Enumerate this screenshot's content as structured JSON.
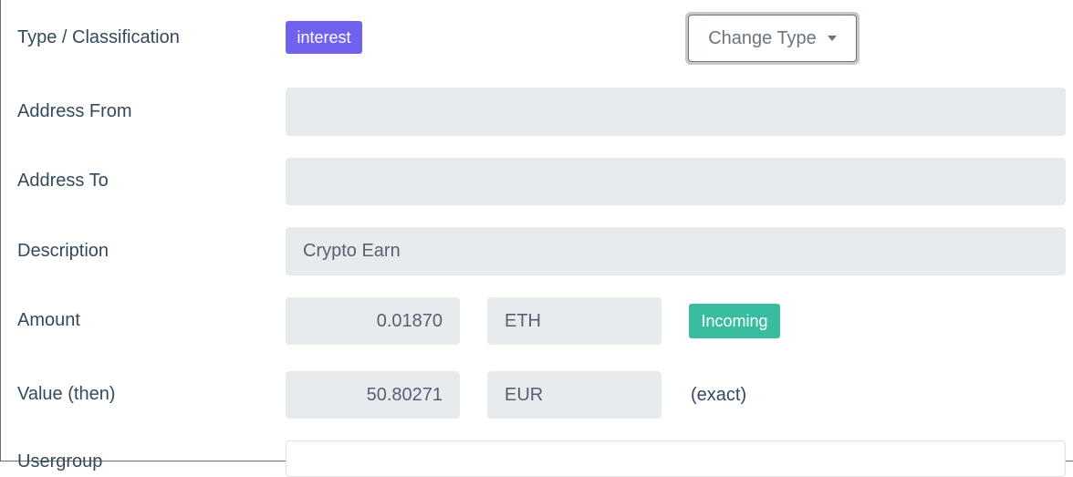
{
  "form": {
    "type_classification": {
      "label": "Type / Classification",
      "badge": "interest",
      "change_type_button": "Change Type"
    },
    "address_from": {
      "label": "Address From",
      "value": ""
    },
    "address_to": {
      "label": "Address To",
      "value": ""
    },
    "description": {
      "label": "Description",
      "value": "Crypto Earn"
    },
    "amount": {
      "label": "Amount",
      "value": "0.01870",
      "currency": "ETH",
      "direction_badge": "Incoming"
    },
    "value_then": {
      "label": "Value (then)",
      "value": "50.80271",
      "currency": "EUR",
      "note": "(exact)"
    },
    "next_row": {
      "label": "Usergroup"
    }
  },
  "colors": {
    "text": "#34495e",
    "field_background": "#e8ebee",
    "type_badge": "#7161ef",
    "incoming_badge": "#39bda1"
  },
  "icons": {
    "dropdown": "caret-down-icon"
  }
}
